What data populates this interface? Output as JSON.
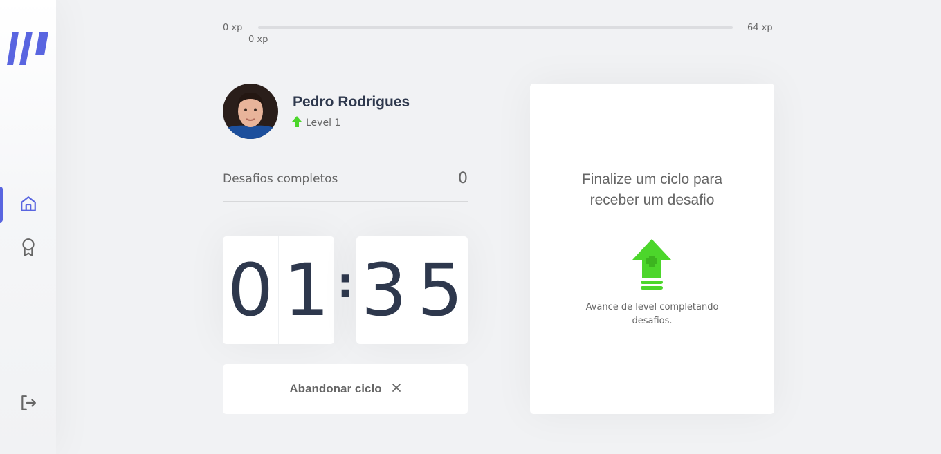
{
  "xp": {
    "start_label": "0 xp",
    "current_label": "0 xp",
    "end_label": "64 xp",
    "progress_percent": 0,
    "accent_color": "#4cd62b"
  },
  "sidebar": {
    "logo_icon": "move-it-logo",
    "items": [
      {
        "icon": "home-icon",
        "active": true
      },
      {
        "icon": "award-icon",
        "active": false
      }
    ],
    "logout_icon": "logout-icon",
    "accent_color": "#5965e0"
  },
  "profile": {
    "name": "Pedro Rodrigues",
    "level_label": "Level 1",
    "level_icon": "level-up-arrow-icon"
  },
  "challenges": {
    "completed_label": "Desafios completos",
    "completed_count": "0"
  },
  "countdown": {
    "min_left": "0",
    "min_right": "1",
    "sec_left": "3",
    "sec_right": "5",
    "separator": ":"
  },
  "abandon_button": {
    "label": "Abandonar ciclo",
    "icon": "close-icon"
  },
  "challenge_box": {
    "title": "Finalize um ciclo para receber um desafio",
    "icon": "level-up-icon",
    "hint": "Avance de level completando desafios."
  }
}
